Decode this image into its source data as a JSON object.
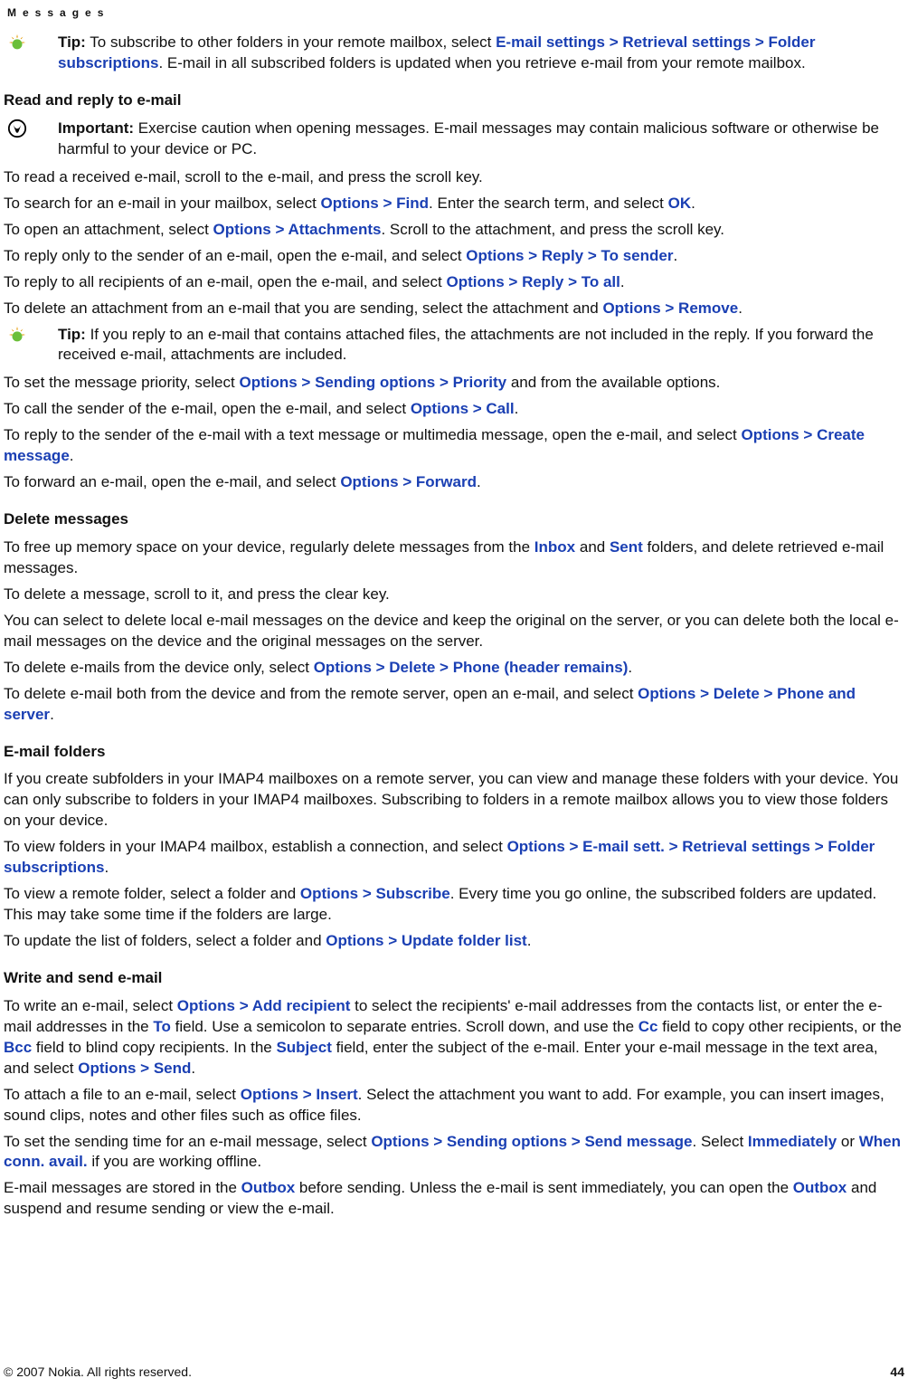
{
  "header": "Messages",
  "tip1": {
    "label": "Tip:",
    "t1": " To subscribe to other folders in your remote mailbox, select ",
    "l1": "E-mail settings",
    "l2": "Retrieval settings",
    "l3": "Folder subscriptions",
    "t2": ". E-mail in all subscribed folders is updated when you retrieve e-mail from your remote mailbox."
  },
  "s1": {
    "title": "Read and reply to e-mail",
    "impLabel": "Important:  ",
    "impText": "Exercise caution when opening messages. E-mail messages may contain malicious software or otherwise be harmful to your device or PC.",
    "p1": "To read a received e-mail, scroll to the e-mail, and press the scroll key.",
    "p2a": "To search for an e-mail in your mailbox, select ",
    "p2l1": "Options",
    "p2l2": "Find",
    "p2b": ". Enter the search term, and select ",
    "p2l3": "OK",
    "p2c": ".",
    "p3a": "To open an attachment, select ",
    "p3l1": "Options",
    "p3l2": "Attachments",
    "p3b": ". Scroll to the attachment, and press the scroll key.",
    "p4a": "To reply only to the sender of an e-mail, open the e-mail, and select ",
    "p4l1": "Options",
    "p4l2": "Reply",
    "p4l3": "To sender",
    "p4b": ".",
    "p5a": "To reply to all recipients of an e-mail, open the e-mail, and select ",
    "p5l1": "Options",
    "p5l2": "Reply",
    "p5l3": "To all",
    "p5b": ".",
    "p6a": "To delete an attachment from an e-mail that you are sending, select the attachment and ",
    "p6l1": "Options",
    "p6l2": "Remove",
    "p6b": "."
  },
  "tip2": {
    "label": "Tip:",
    "text": " If you reply to an e-mail that contains attached files, the attachments are not included in the reply. If you forward the received e-mail, attachments are included."
  },
  "s1b": {
    "p7a": "To set the message priority, select ",
    "p7l1": "Options",
    "p7l2": "Sending options",
    "p7l3": "Priority",
    "p7b": " and from the available options.",
    "p8a": "To call the sender of the e-mail, open the e-mail, and select ",
    "p8l1": "Options",
    "p8l2": "Call",
    "p8b": ".",
    "p9a": "To reply to the sender of the e-mail with a text message or multimedia message, open the e-mail, and select ",
    "p9l1": "Options",
    "p9l2": "Create message",
    "p9b": ".",
    "p10a": "To forward an e-mail, open the e-mail, and select ",
    "p10l1": "Options",
    "p10l2": "Forward",
    "p10b": "."
  },
  "s2": {
    "title": "Delete messages",
    "p1a": "To free up memory space on your device, regularly delete messages from the ",
    "p1l1": "Inbox",
    "p1b": " and ",
    "p1l2": "Sent",
    "p1c": " folders, and delete retrieved e-mail messages.",
    "p2": "To delete a message, scroll to it, and press the clear key.",
    "p3": "You can select to delete local e-mail messages on the device and keep the original on the server, or you can delete both the local e-mail messages on the device and the original messages on the server.",
    "p4a": "To delete e-mails from the device only, select ",
    "p4l1": "Options",
    "p4l2": "Delete",
    "p4l3": "Phone (header remains)",
    "p4b": ".",
    "p5a": "To delete e-mail both from the device and from the remote server, open an e-mail, and select ",
    "p5l1": "Options",
    "p5l2": "Delete",
    "p5l3": "Phone and server",
    "p5b": "."
  },
  "s3": {
    "title": "E-mail folders",
    "p1": "If you create subfolders in your IMAP4 mailboxes on a remote server, you can view and manage these folders with your device. You can only subscribe to folders in your IMAP4 mailboxes. Subscribing to folders in a remote mailbox allows you to view those folders on your device.",
    "p2a": "To view folders in your IMAP4 mailbox, establish a connection, and select ",
    "p2l1": "Options",
    "p2l2": "E-mail sett.",
    "p2l3": "Retrieval settings",
    "p2l4": "Folder subscriptions",
    "p2b": ".",
    "p3a": "To view a remote folder, select a folder and ",
    "p3l1": "Options",
    "p3l2": "Subscribe",
    "p3b": ". Every time you go online, the subscribed folders are updated. This may take some time if the folders are large.",
    "p4a": "To update the list of folders, select a folder and ",
    "p4l1": "Options",
    "p4l2": "Update folder list",
    "p4b": "."
  },
  "s4": {
    "title": "Write and send e-mail",
    "p1a": "To write an e-mail, select ",
    "p1l1": "Options",
    "p1l2": "Add recipient",
    "p1b": " to select the recipients' e-mail addresses from the contacts list, or enter the e-mail addresses in the ",
    "p1l3": "To",
    "p1c": " field. Use a semicolon to separate entries. Scroll down, and use the ",
    "p1l4": "Cc",
    "p1d": " field to copy other recipients, or the ",
    "p1l5": "Bcc",
    "p1e": " field to blind copy recipients. In the ",
    "p1l6": "Subject",
    "p1f": " field, enter the subject of the e-mail. Enter your e-mail message in the text area, and select ",
    "p1l7": "Options",
    "p1l8": "Send",
    "p1g": ".",
    "p2a": "To attach a file to an e-mail, select ",
    "p2l1": "Options",
    "p2l2": "Insert",
    "p2b": ". Select the attachment you want to add. For example, you can insert images, sound clips, notes and other files such as office files.",
    "p3a": "To set the sending time for an e-mail message, select ",
    "p3l1": "Options",
    "p3l2": "Sending options",
    "p3l3": "Send message",
    "p3b": ". Select ",
    "p3l4": "Immediately",
    "p3c": " or ",
    "p3l5": "When conn. avail.",
    "p3d": " if you are working offline.",
    "p4a": "E-mail messages are stored in the ",
    "p4l1": "Outbox",
    "p4b": " before sending. Unless the e-mail is sent immediately, you can open the ",
    "p4l2": "Outbox",
    "p4c": " and suspend and resume sending or view the e-mail."
  },
  "footer": {
    "copy": "© 2007 Nokia. All rights reserved.",
    "page": "44"
  }
}
